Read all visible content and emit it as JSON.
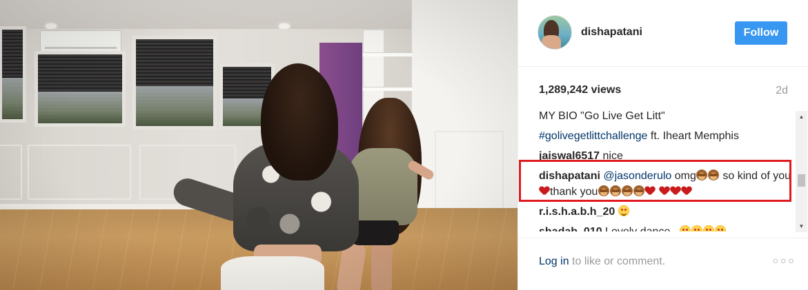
{
  "post": {
    "username": "dishapatani",
    "follow_label": "Follow",
    "views": "1,289,242 views",
    "age": "2d"
  },
  "comments": [
    {
      "user": "",
      "parts": [
        {
          "t": "text",
          "v": "MY BIO \"Go Live Get Litt\""
        }
      ]
    },
    {
      "user": "",
      "parts": [
        {
          "t": "tag",
          "v": "#golivegetlittchallenge"
        },
        {
          "t": "text",
          "v": " ft. Iheart Memphis"
        }
      ]
    },
    {
      "user": "jaiswal6517",
      "parts": [
        {
          "t": "text",
          "v": " nice"
        }
      ]
    },
    {
      "user": "dishapatani",
      "parts": [
        {
          "t": "text",
          "v": " "
        },
        {
          "t": "tag",
          "v": "@jasonderulo"
        },
        {
          "t": "text",
          "v": " omg"
        },
        {
          "t": "icon",
          "v": "monkey"
        },
        {
          "t": "icon",
          "v": "monkey"
        },
        {
          "t": "text",
          "v": " so kind of you"
        },
        {
          "t": "icon",
          "v": "heart"
        },
        {
          "t": "text",
          "v": "thank you"
        },
        {
          "t": "icon",
          "v": "monkey"
        },
        {
          "t": "icon",
          "v": "monkey"
        },
        {
          "t": "icon",
          "v": "monkey"
        },
        {
          "t": "icon",
          "v": "monkey"
        },
        {
          "t": "icon",
          "v": "heart"
        },
        {
          "t": "text",
          "v": " "
        },
        {
          "t": "icon",
          "v": "heart"
        },
        {
          "t": "icon",
          "v": "heart"
        },
        {
          "t": "icon",
          "v": "heart"
        }
      ]
    },
    {
      "user": "r.i.s.h.a.b.h_20",
      "parts": [
        {
          "t": "text",
          "v": " "
        },
        {
          "t": "icon",
          "v": "smile"
        }
      ]
    },
    {
      "user": "shadab_010",
      "parts": [
        {
          "t": "text",
          "v": " Lovely dance.. "
        },
        {
          "t": "icon",
          "v": "smile"
        },
        {
          "t": "icon",
          "v": "smile"
        },
        {
          "t": "icon",
          "v": "smile"
        },
        {
          "t": "icon",
          "v": "smile"
        }
      ]
    }
  ],
  "footer": {
    "login_link": "Log in",
    "login_rest": " to like or comment.",
    "more_icon": "more-options-icon"
  },
  "colors": {
    "follow_button": "#3897f0",
    "link": "#003569",
    "highlight_box": "#e0191e"
  }
}
